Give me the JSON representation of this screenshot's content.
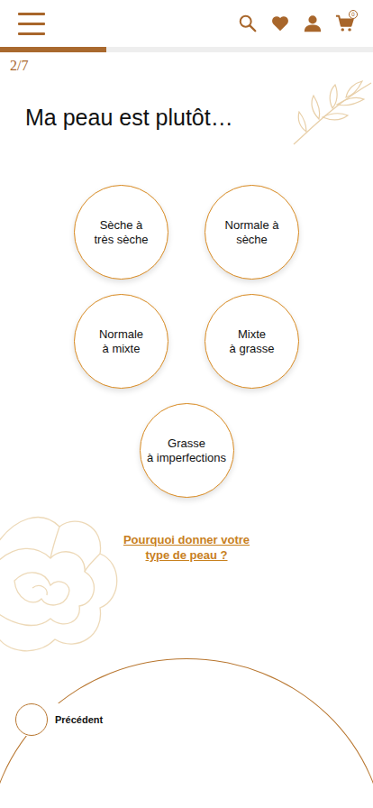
{
  "header": {
    "cart_badge": "0"
  },
  "progress": {
    "step": "2/7",
    "level": 0.2857
  },
  "question": "Ma peau est plutôt…",
  "options": [
    {
      "label": "Sèche à\ntrès sèche",
      "selected": false
    },
    {
      "label": "Normale à\nsèche",
      "selected": false
    },
    {
      "label": "Normale\nà mixte",
      "selected": false
    },
    {
      "label": "Mixte\nà grasse",
      "selected": false
    },
    {
      "label": "Grasse\nà imperfections",
      "selected": false
    }
  ],
  "help_link": "Pourquoi donner votre\ntype de peau ?",
  "footer": {
    "previous": "Précédent"
  }
}
